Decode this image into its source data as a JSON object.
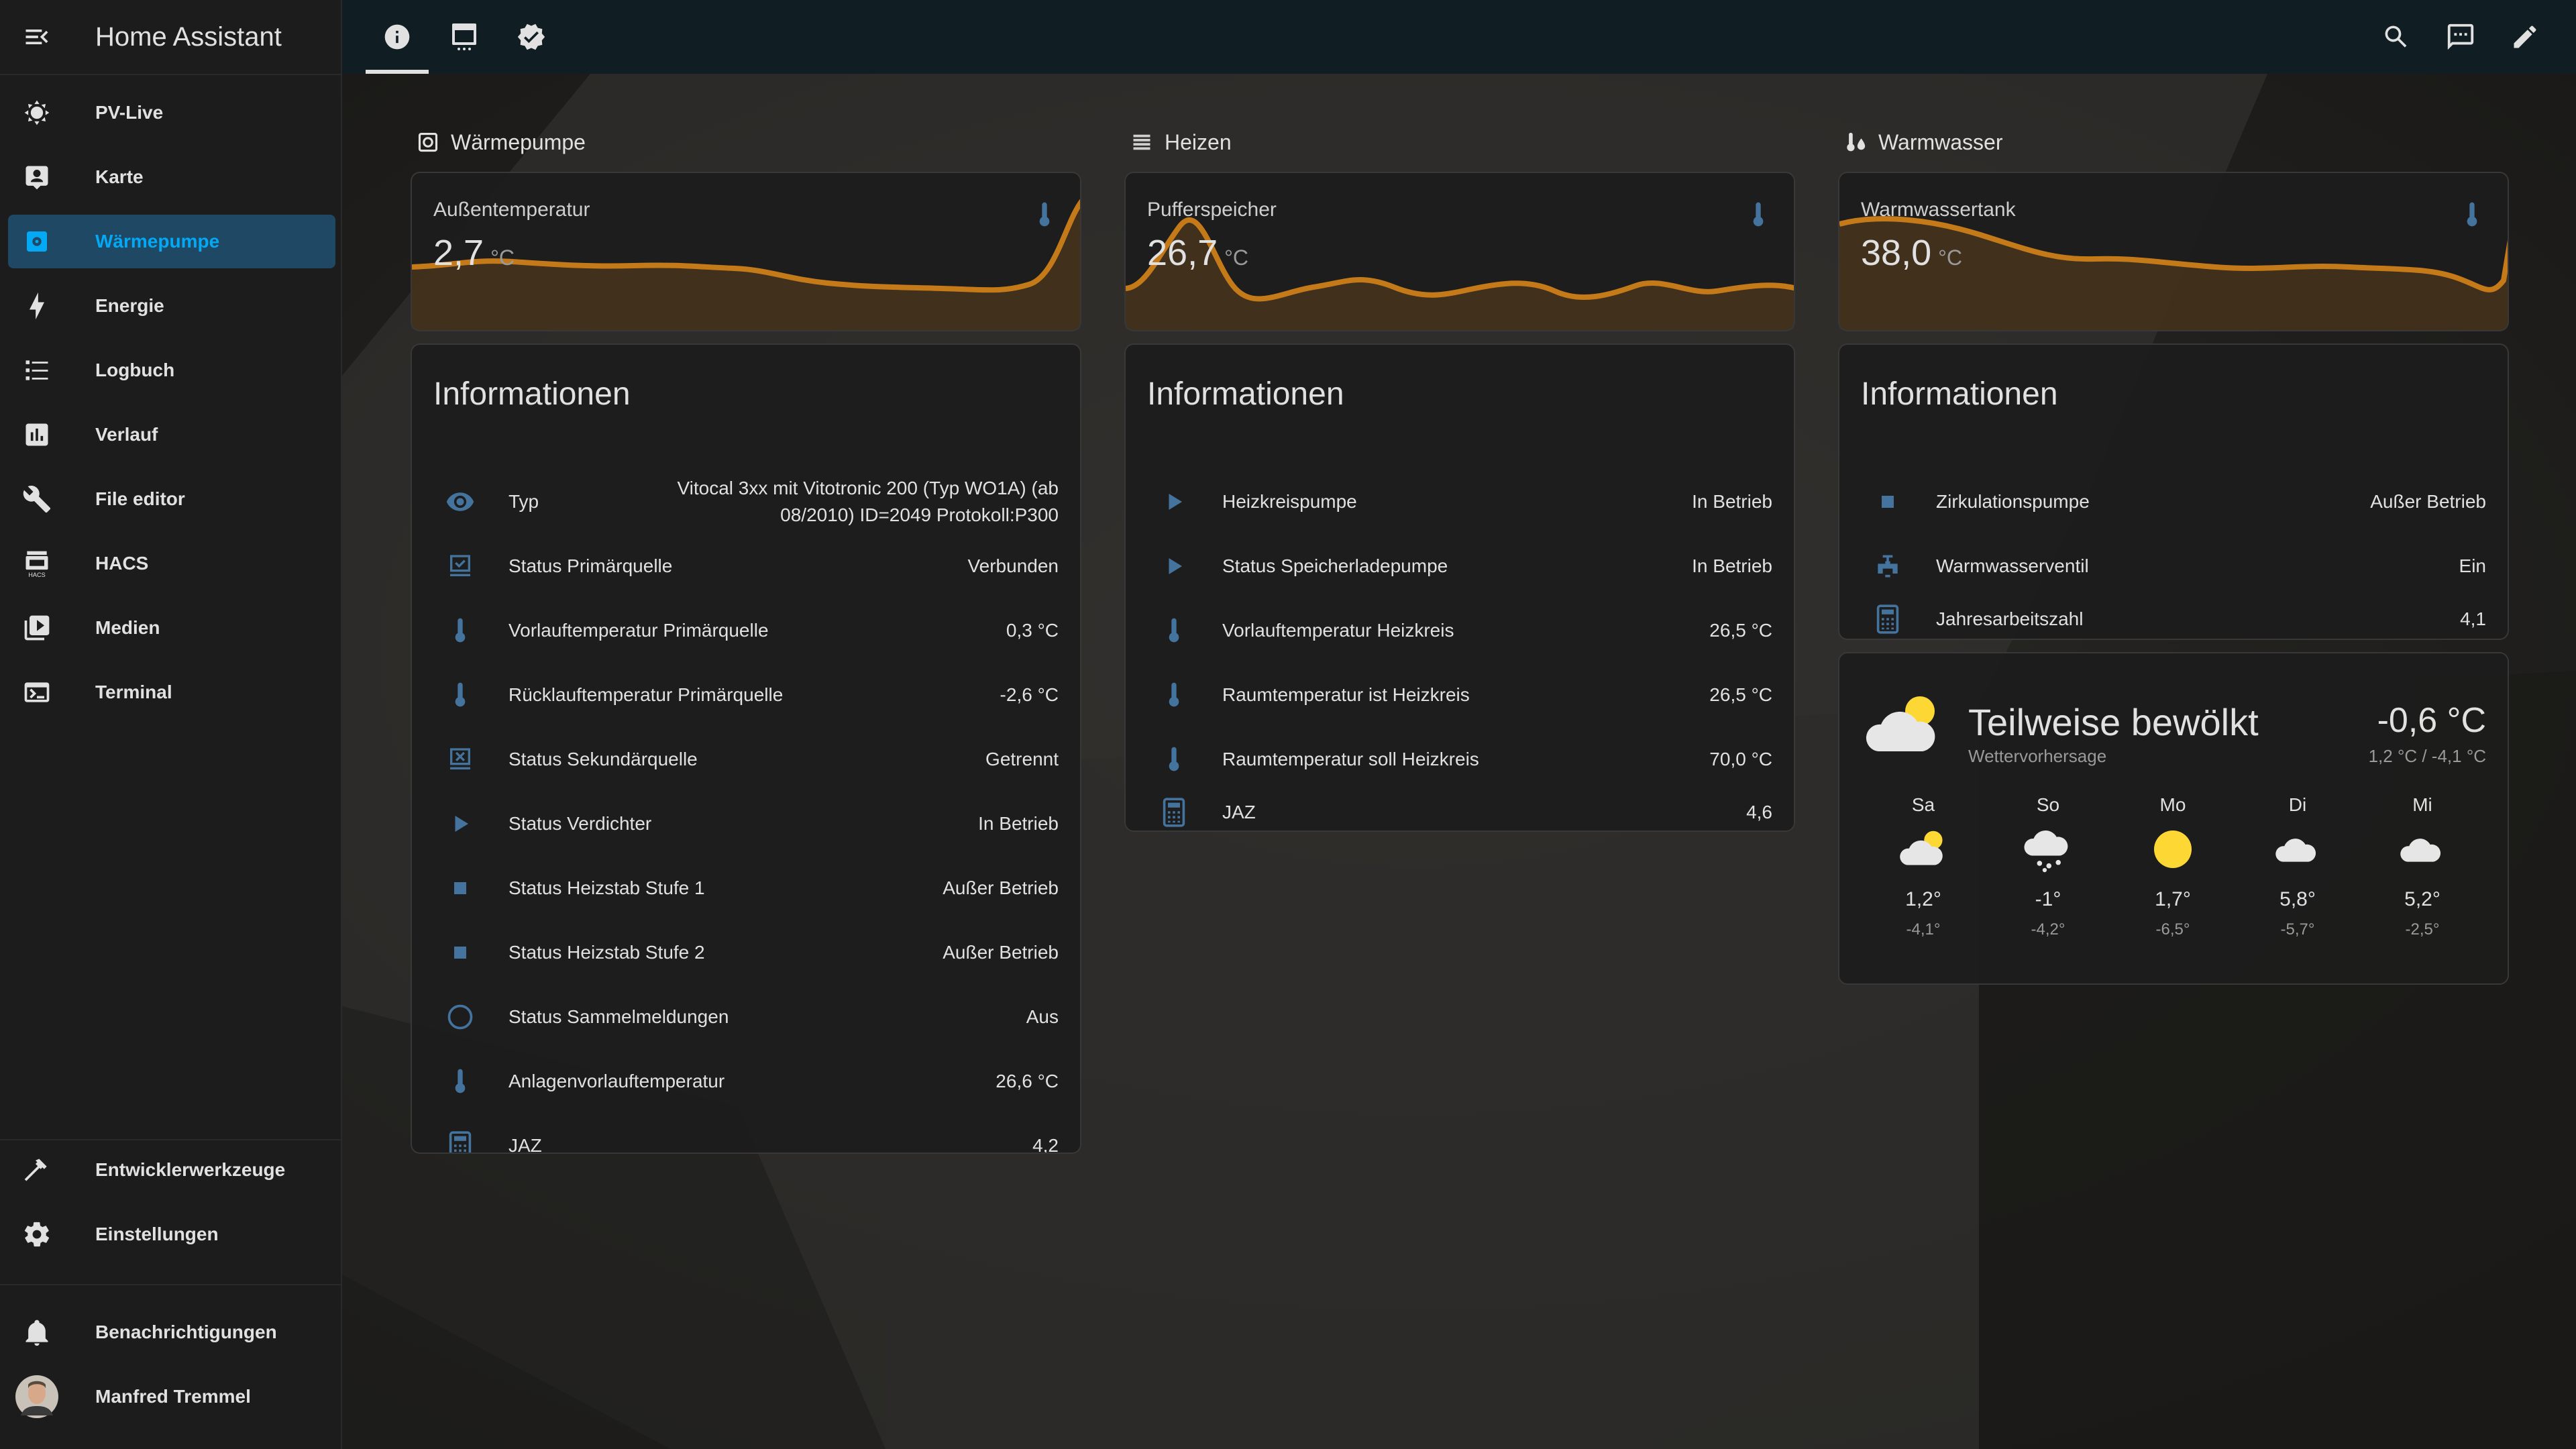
{
  "app": {
    "title": "Home Assistant"
  },
  "sidebar": {
    "items": [
      {
        "label": "PV-Live",
        "icon": "sun-icon"
      },
      {
        "label": "Karte",
        "icon": "map-account-icon"
      },
      {
        "label": "Wärmepumpe",
        "icon": "heat-pump-icon",
        "active": true
      },
      {
        "label": "Energie",
        "icon": "lightning-icon"
      },
      {
        "label": "Logbuch",
        "icon": "list-icon"
      },
      {
        "label": "Verlauf",
        "icon": "chart-box-icon"
      },
      {
        "label": "File editor",
        "icon": "wrench-icon"
      },
      {
        "label": "HACS",
        "icon": "hacs-icon"
      },
      {
        "label": "Medien",
        "icon": "play-box-icon"
      },
      {
        "label": "Terminal",
        "icon": "console-icon"
      }
    ],
    "bottom": [
      {
        "label": "Entwicklerwerkzeuge",
        "icon": "hammer-icon"
      },
      {
        "label": "Einstellungen",
        "icon": "gear-icon"
      },
      {
        "label": "Benachrichtigungen",
        "icon": "bell-icon"
      },
      {
        "label": "Manfred Tremmel",
        "icon": "avatar"
      }
    ]
  },
  "topbar": {
    "tabs": [
      "info-icon",
      "view-dashboard-icon",
      "check-decagram-icon"
    ],
    "actions": [
      "search-icon",
      "assist-icon",
      "pencil-icon"
    ]
  },
  "colors": {
    "accent": "#03a9f4",
    "graph": "#c57a1a",
    "icon": "#44739e",
    "sun": "#fdd835"
  },
  "columns": [
    {
      "title": "Wärmepumpe",
      "sensor": {
        "name": "Außentemperatur",
        "value": "2,7",
        "unit": "°C"
      },
      "entities": {
        "title": "Informationen",
        "rows": [
          {
            "icon": "eye-icon",
            "name": "Typ",
            "value": "Vitocal 3xx mit Vitotronic 200 (Typ WO1A) (ab 08/2010) ID=2049 Protokoll:P300"
          },
          {
            "icon": "checkbox-marked-icon",
            "name": "Status Primärquelle",
            "value": "Verbunden"
          },
          {
            "icon": "thermometer-icon",
            "name": "Vorlauftemperatur Primärquelle",
            "value": "0,3 °C"
          },
          {
            "icon": "thermometer-icon",
            "name": "Rücklauftemperatur Primärquelle",
            "value": "-2,6 °C"
          },
          {
            "icon": "close-box-icon",
            "name": "Status Sekundärquelle",
            "value": "Getrennt"
          },
          {
            "icon": "play-icon",
            "name": "Status Verdichter",
            "value": "In Betrieb"
          },
          {
            "icon": "stop-icon",
            "name": "Status Heizstab Stufe 1",
            "value": "Außer Betrieb"
          },
          {
            "icon": "stop-icon",
            "name": "Status Heizstab Stufe 2",
            "value": "Außer Betrieb"
          },
          {
            "icon": "circle-outline-icon",
            "name": "Status Sammelmeldungen",
            "value": "Aus"
          },
          {
            "icon": "thermometer-icon",
            "name": "Anlagenvorlauftemperatur",
            "value": "26,6 °C"
          },
          {
            "icon": "calculator-icon",
            "name": "JAZ",
            "value": "4,2"
          }
        ]
      }
    },
    {
      "title": "Heizen",
      "sensor": {
        "name": "Pufferspeicher",
        "value": "26,7",
        "unit": "°C"
      },
      "entities": {
        "title": "Informationen",
        "rows": [
          {
            "icon": "play-icon",
            "name": "Heizkreispumpe",
            "value": "In Betrieb"
          },
          {
            "icon": "play-icon",
            "name": "Status Speicherladepumpe",
            "value": "In Betrieb"
          },
          {
            "icon": "thermometer-icon",
            "name": "Vorlauftemperatur Heizkreis",
            "value": "26,5 °C"
          },
          {
            "icon": "thermometer-icon",
            "name": "Raumtemperatur ist Heizkreis",
            "value": "26,5 °C"
          },
          {
            "icon": "thermometer-icon",
            "name": "Raumtemperatur soll Heizkreis",
            "value": "70,0 °C"
          },
          {
            "icon": "calculator-icon",
            "name": "JAZ",
            "value": "4,6"
          }
        ]
      }
    },
    {
      "title": "Warmwasser",
      "sensor": {
        "name": "Warmwassertank",
        "value": "38,0",
        "unit": "°C"
      },
      "entities": {
        "title": "Informationen",
        "rows": [
          {
            "icon": "stop-icon",
            "name": "Zirkulationspumpe",
            "value": "Außer Betrieb"
          },
          {
            "icon": "valve-icon",
            "name": "Warmwasserventil",
            "value": "Ein"
          },
          {
            "icon": "calculator-icon",
            "name": "Jahresarbeitszahl",
            "value": "4,1"
          }
        ]
      },
      "weather": {
        "condition": "Teilweise bewölkt",
        "source": "Wettervorhersage",
        "temperature": "-0,6 °C",
        "high_low": "1,2 °C / -4,1 °C",
        "forecast": [
          {
            "day": "Sa",
            "icon": "partly-cloudy-icon",
            "high": "1,2°",
            "low": "-4,1°"
          },
          {
            "day": "So",
            "icon": "snowy-icon",
            "high": "-1°",
            "low": "-4,2°"
          },
          {
            "day": "Mo",
            "icon": "sunny-icon",
            "high": "1,7°",
            "low": "-6,5°"
          },
          {
            "day": "Di",
            "icon": "cloudy-icon",
            "high": "5,8°",
            "low": "-5,7°"
          },
          {
            "day": "Mi",
            "icon": "cloudy-icon",
            "high": "5,2°",
            "low": "-2,5°"
          }
        ]
      }
    }
  ]
}
